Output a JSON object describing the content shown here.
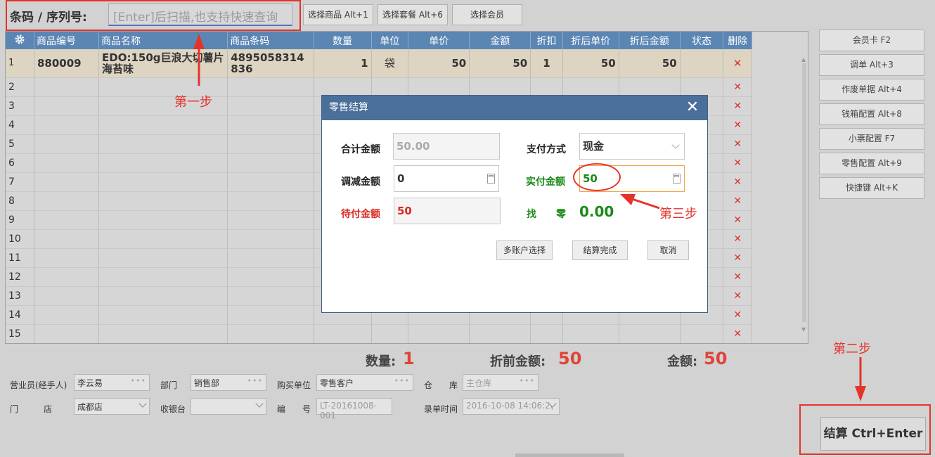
{
  "top": {
    "barcode_label": "条码 / 序列号:",
    "barcode_placeholder": "[Enter]后扫描,也支持快速查询",
    "buttons": [
      "选择商品 Alt+1",
      "选择套餐 Alt+6",
      "选择会员"
    ]
  },
  "grid": {
    "columns": [
      "商品编号",
      "商品名称",
      "商品条码",
      "数量",
      "单位",
      "单价",
      "金额",
      "折扣",
      "折后单价",
      "折后金额",
      "状态",
      "删除"
    ],
    "row1": {
      "idx": "1",
      "code": "880009",
      "name": "EDO:150g巨浪大切薯片海苔味",
      "barcode": "4895058314836",
      "qty": "1",
      "unit": "袋",
      "price": "50",
      "amount": "50",
      "discount": "1",
      "disc_price": "50",
      "disc_amount": "50"
    },
    "empty_rows": [
      "2",
      "3",
      "4",
      "5",
      "6",
      "7",
      "8",
      "9",
      "10",
      "11",
      "12",
      "13",
      "14",
      "15"
    ],
    "delete_glyph": "✕"
  },
  "side_buttons": [
    "会员卡 F2",
    "调单 Alt+3",
    "作废单据 Alt+4",
    "钱箱配置 Alt+8",
    "小票配置 F7",
    "零售配置 Alt+9",
    "快捷键 Alt+K"
  ],
  "annotations": {
    "step1": "第一步",
    "step2": "第二步",
    "step3": "第三步"
  },
  "totals": {
    "qty_label": "数量:",
    "qty": "1",
    "pre_label": "折前金额:",
    "pre": "50",
    "amount_label": "金额:",
    "amount": "50"
  },
  "footer": {
    "salesperson_label": "营业员(经手人)",
    "salesperson": "李云易",
    "dept_label": "部门",
    "dept": "销售部",
    "buyer_label": "购买单位",
    "buyer": "零售客户",
    "warehouse_label": "仓　　库",
    "warehouse": "主仓库",
    "store_label": "门　　　店",
    "store": "成都店",
    "register_label": "收银台",
    "register": "",
    "number_label": "编　　号",
    "number": "LT-20161008-001",
    "time_label": "录单时间",
    "time": "2016-10-08 14:06:2("
  },
  "checkout_button": "结算 Ctrl+Enter",
  "dialog": {
    "title": "零售结算",
    "total_label": "合计金额",
    "total": "50.00",
    "payment_label": "支付方式",
    "payment": "现金",
    "adjust_label": "调减金额",
    "adjust": "0",
    "paid_label": "实付金额",
    "paid": "50",
    "due_label": "待付金额",
    "due": "50",
    "change_label": "找　　零",
    "change": "0.00",
    "btn_multi": "多账户选择",
    "btn_done": "结算完成",
    "btn_cancel": "取消"
  },
  "colors": {
    "header_blue": "#5b86b4",
    "dialog_blue": "#4a6f9a",
    "red": "#e5332a",
    "green": "#1a8a1a"
  }
}
